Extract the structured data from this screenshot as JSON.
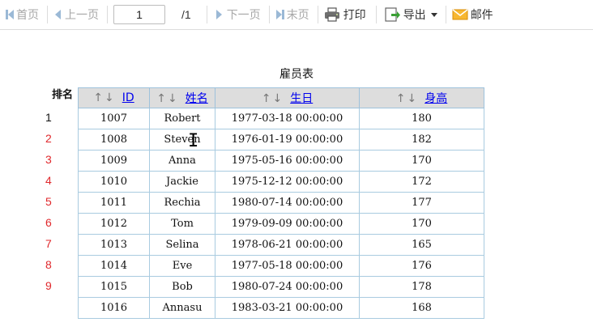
{
  "toolbar": {
    "first": "首页",
    "prev": "上一页",
    "page_value": "1",
    "total": "/1",
    "next": "下一页",
    "last": "末页",
    "print": "打印",
    "export": "导出",
    "mail": "邮件"
  },
  "report": {
    "title": "雇员表",
    "rank_header": "排名",
    "sort_arrows": "↑↓",
    "columns": [
      "ID",
      "姓名",
      "生日",
      "身高"
    ],
    "rows": [
      {
        "rank": "1",
        "id": "1007",
        "name": "Robert",
        "birthday": "1977-03-18 00:00:00",
        "height": "180"
      },
      {
        "rank": "2",
        "id": "1008",
        "name": "Steven",
        "birthday": "1976-01-19 00:00:00",
        "height": "182"
      },
      {
        "rank": "3",
        "id": "1009",
        "name": "Anna",
        "birthday": "1975-05-16 00:00:00",
        "height": "170"
      },
      {
        "rank": "4",
        "id": "1010",
        "name": "Jackie",
        "birthday": "1975-12-12 00:00:00",
        "height": "172"
      },
      {
        "rank": "5",
        "id": "1011",
        "name": "Rechia",
        "birthday": "1980-07-14 00:00:00",
        "height": "177"
      },
      {
        "rank": "6",
        "id": "1012",
        "name": "Tom",
        "birthday": "1979-09-09 00:00:00",
        "height": "170"
      },
      {
        "rank": "7",
        "id": "1013",
        "name": "Selina",
        "birthday": "1978-06-21 00:00:00",
        "height": "165"
      },
      {
        "rank": "8",
        "id": "1014",
        "name": "Eve",
        "birthday": "1977-05-18 00:00:00",
        "height": "176"
      },
      {
        "rank": "9",
        "id": "1015",
        "name": "Bob",
        "birthday": "1980-07-24 00:00:00",
        "height": "178"
      },
      {
        "rank": "",
        "id": "1016",
        "name": "Annasu",
        "birthday": "1983-03-21 00:00:00",
        "height": "168"
      }
    ]
  },
  "colors": {
    "rank_first": "#111111",
    "rank_other": "#e0282c",
    "header_bg": "#dddddd",
    "grid_border": "#a9cbe0",
    "disabled_text": "#a7a7a7"
  },
  "icons": [
    "first-page-icon",
    "prev-page-icon",
    "next-page-icon",
    "last-page-icon",
    "printer-icon",
    "export-icon",
    "dropdown-arrow-icon",
    "mail-icon",
    "text-cursor-icon"
  ]
}
